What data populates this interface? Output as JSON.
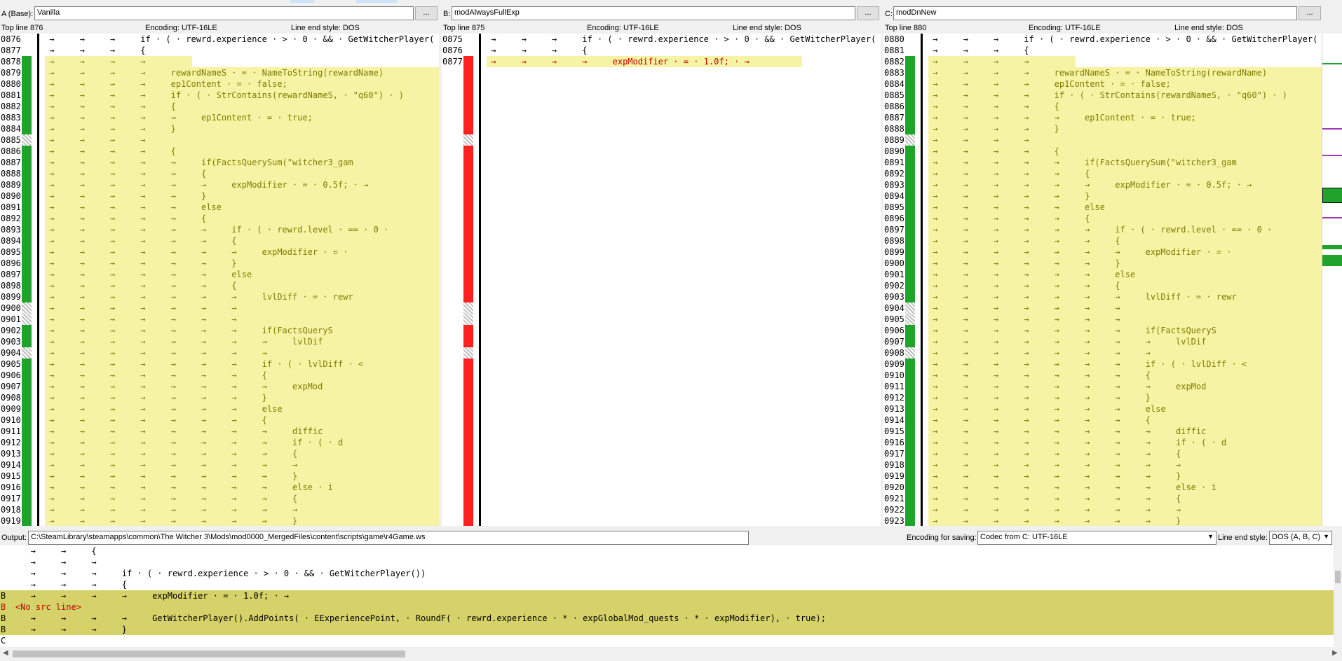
{
  "panes": [
    {
      "id": "A",
      "label": "A (Base):",
      "name": "Vanilla",
      "browse": "...",
      "top_line": "Top line 876",
      "encoding": "Encoding: UTF-16LE",
      "line_end": "Line end style: DOS",
      "lines": [
        {
          "n": "0876",
          "code": " →     →     →     if · ( · rewrd.experience · > · 0 · && · GetWitcherPlayer(",
          "mark": "",
          "hl": false
        },
        {
          "n": "0877",
          "code": " →     →     →     {",
          "mark": "",
          "hl": false
        },
        {
          "n": "0878",
          "code": " →     →     →     →",
          "mark": "green",
          "hl": true,
          "hlw": 210
        },
        {
          "n": "0879",
          "code": " →     →     →     →     rewardNameS · = · NameToString(rewardName)",
          "mark": "green",
          "hl": true
        },
        {
          "n": "0880",
          "code": " →     →     →     →     ep1Content · = · false;",
          "mark": "green",
          "hl": true
        },
        {
          "n": "0881",
          "code": " →     →     →     →     if · ( · StrContains(rewardNameS, · \"q60\") · )",
          "mark": "green",
          "hl": true
        },
        {
          "n": "0882",
          "code": " →     →     →     →     {",
          "mark": "green",
          "hl": true
        },
        {
          "n": "0883",
          "code": " →     →     →     →     →     ep1Content · = · true;",
          "mark": "green",
          "hl": true
        },
        {
          "n": "0884",
          "code": " →     →     →     →     }",
          "mark": "green",
          "hl": true
        },
        {
          "n": "0885",
          "code": " →     →     →     →",
          "mark": "hatch",
          "hl": true
        },
        {
          "n": "0886",
          "code": " →     →     →     →     {",
          "mark": "green",
          "hl": true
        },
        {
          "n": "0887",
          "code": " →     →     →     →     →     if(FactsQuerySum(\"witcher3_gam",
          "mark": "green",
          "hl": true
        },
        {
          "n": "0888",
          "code": " →     →     →     →     →     {",
          "mark": "green",
          "hl": true
        },
        {
          "n": "0889",
          "code": " →     →     →     →     →     →     expModifier · = · 0.5f; · →",
          "mark": "green",
          "hl": true
        },
        {
          "n": "0890",
          "code": " →     →     →     →     →     }",
          "mark": "green",
          "hl": true
        },
        {
          "n": "0891",
          "code": " →     →     →     →     →     else",
          "mark": "green",
          "hl": true
        },
        {
          "n": "0892",
          "code": " →     →     →     →     →     {",
          "mark": "green",
          "hl": true
        },
        {
          "n": "0893",
          "code": " →     →     →     →     →     →     if · ( · rewrd.level · == · 0 ·",
          "mark": "green",
          "hl": true
        },
        {
          "n": "0894",
          "code": " →     →     →     →     →     →     {",
          "mark": "green",
          "hl": true
        },
        {
          "n": "0895",
          "code": " →     →     →     →     →     →     →     expModifier · = ·",
          "mark": "green",
          "hl": true
        },
        {
          "n": "0896",
          "code": " →     →     →     →     →     →     }",
          "mark": "green",
          "hl": true
        },
        {
          "n": "0897",
          "code": " →     →     →     →     →     →     else",
          "mark": "green",
          "hl": true
        },
        {
          "n": "0898",
          "code": " →     →     →     →     →     →     {",
          "mark": "green",
          "hl": true
        },
        {
          "n": "0899",
          "code": " →     →     →     →     →     →     →     lvlDiff · = · rewr",
          "mark": "green",
          "hl": true
        },
        {
          "n": "0900",
          "code": " →     →     →     →     →     →     →",
          "mark": "hatch",
          "hl": true
        },
        {
          "n": "0901",
          "code": " →     →     →     →     →     →     →",
          "mark": "hatch",
          "hl": true
        },
        {
          "n": "0902",
          "code": " →     →     →     →     →     →     →     if(FactsQueryS",
          "mark": "green",
          "hl": true
        },
        {
          "n": "0903",
          "code": " →     →     →     →     →     →     →     →     lvlDif",
          "mark": "green",
          "hl": true
        },
        {
          "n": "0904",
          "code": " →     →     →     →     →     →     →     →",
          "mark": "hatch",
          "hl": true
        },
        {
          "n": "0905",
          "code": " →     →     →     →     →     →     →     if · ( · lvlDiff · <",
          "mark": "green",
          "hl": true
        },
        {
          "n": "0906",
          "code": " →     →     →     →     →     →     →     {",
          "mark": "green",
          "hl": true
        },
        {
          "n": "0907",
          "code": " →     →     →     →     →     →     →     →     expMod",
          "mark": "green",
          "hl": true
        },
        {
          "n": "0908",
          "code": " →     →     →     →     →     →     →     }",
          "mark": "green",
          "hl": true
        },
        {
          "n": "0909",
          "code": " →     →     →     →     →     →     →     else",
          "mark": "green",
          "hl": true
        },
        {
          "n": "0910",
          "code": " →     →     →     →     →     →     →     {",
          "mark": "green",
          "hl": true
        },
        {
          "n": "0911",
          "code": " →     →     →     →     →     →     →     →     diffic",
          "mark": "green",
          "hl": true
        },
        {
          "n": "0912",
          "code": " →     →     →     →     →     →     →     →     if · ( · d",
          "mark": "green",
          "hl": true
        },
        {
          "n": "0913",
          "code": " →     →     →     →     →     →     →     →     {",
          "mark": "green",
          "hl": true
        },
        {
          "n": "0914",
          "code": " →     →     →     →     →     →     →     →     →",
          "mark": "green",
          "hl": true
        },
        {
          "n": "0915",
          "code": " →     →     →     →     →     →     →     →     }",
          "mark": "green",
          "hl": true
        },
        {
          "n": "0916",
          "code": " →     →     →     →     →     →     →     →     else · i",
          "mark": "green",
          "hl": true
        },
        {
          "n": "0917",
          "code": " →     →     →     →     →     →     →     →     {",
          "mark": "green",
          "hl": true
        },
        {
          "n": "0918",
          "code": " →     →     →     →     →     →     →     →     →",
          "mark": "green",
          "hl": true
        },
        {
          "n": "0919",
          "code": " →     →     →     →     →     →     →     →     }",
          "mark": "green",
          "hl": true
        }
      ]
    },
    {
      "id": "B",
      "label": "B:",
      "name": "modAlwaysFullExp",
      "browse": "...",
      "top_line": "Top line 875",
      "encoding": "Encoding: UTF-16LE",
      "line_end": "Line end style: DOS",
      "lines": [
        {
          "n": "0875",
          "code": " →     →     →     if · ( · rewrd.experience · > · 0 · && · GetWitcherPlayer(",
          "mark": "",
          "hl": false
        },
        {
          "n": "0876",
          "code": " →     →     →     {",
          "mark": "",
          "hl": false
        },
        {
          "n": "0877",
          "code": " →     →     →     →     expModifier · = · 1.0f; · →",
          "mark": "red",
          "hl": true,
          "hlw": 450,
          "red": true
        }
      ],
      "empty_marks": [
        "red",
        "red",
        "red",
        "red",
        "red",
        "red",
        "hatch",
        "red",
        "red",
        "red",
        "red",
        "red",
        "red",
        "red",
        "red",
        "red",
        "red",
        "red",
        "red",
        "red",
        "red",
        "hatch",
        "hatch",
        "red",
        "red",
        "hatch",
        "red",
        "red",
        "red",
        "red",
        "red",
        "red",
        "red",
        "red",
        "red",
        "red",
        "red",
        "red",
        "red",
        "red",
        "red"
      ]
    },
    {
      "id": "C",
      "label": "C:",
      "name": "modDnNew",
      "browse": "...",
      "top_line": "Top line 880",
      "encoding": "Encoding: UTF-16LE",
      "line_end": "Line end style: DOS",
      "lines": [
        {
          "n": "0880",
          "code": " →     →     →     if · ( · rewrd.experience · > · 0 · && · GetWitcherPlayer(",
          "mark": "",
          "hl": false
        },
        {
          "n": "0881",
          "code": " →     →     →     {",
          "mark": "",
          "hl": false
        },
        {
          "n": "0882",
          "code": " →     →     →     →",
          "mark": "green",
          "hl": true,
          "hlw": 210
        },
        {
          "n": "0883",
          "code": " →     →     →     →     rewardNameS · = · NameToString(rewardName)",
          "mark": "green",
          "hl": true
        },
        {
          "n": "0884",
          "code": " →     →     →     →     ep1Content · = · false;",
          "mark": "green",
          "hl": true
        },
        {
          "n": "0885",
          "code": " →     →     →     →     if · ( · StrContains(rewardNameS, · \"q60\") · )",
          "mark": "green",
          "hl": true
        },
        {
          "n": "0886",
          "code": " →     →     →     →     {",
          "mark": "green",
          "hl": true
        },
        {
          "n": "0887",
          "code": " →     →     →     →     →     ep1Content · = · true;",
          "mark": "green",
          "hl": true
        },
        {
          "n": "0888",
          "code": " →     →     →     →     }",
          "mark": "green",
          "hl": true
        },
        {
          "n": "0889",
          "code": " →     →     →     →",
          "mark": "hatch",
          "hl": true
        },
        {
          "n": "0890",
          "code": " →     →     →     →     {",
          "mark": "green",
          "hl": true
        },
        {
          "n": "0891",
          "code": " →     →     →     →     →     if(FactsQuerySum(\"witcher3_gam",
          "mark": "green",
          "hl": true
        },
        {
          "n": "0892",
          "code": " →     →     →     →     →     {",
          "mark": "green",
          "hl": true
        },
        {
          "n": "0893",
          "code": " →     →     →     →     →     →     expModifier · = · 0.5f; · →",
          "mark": "green",
          "hl": true
        },
        {
          "n": "0894",
          "code": " →     →     →     →     →     }",
          "mark": "green",
          "hl": true
        },
        {
          "n": "0895",
          "code": " →     →     →     →     →     else",
          "mark": "green",
          "hl": true
        },
        {
          "n": "0896",
          "code": " →     →     →     →     →     {",
          "mark": "green",
          "hl": true
        },
        {
          "n": "0897",
          "code": " →     →     →     →     →     →     if · ( · rewrd.level · == · 0 ·",
          "mark": "green",
          "hl": true
        },
        {
          "n": "0898",
          "code": " →     →     →     →     →     →     {",
          "mark": "green",
          "hl": true
        },
        {
          "n": "0899",
          "code": " →     →     →     →     →     →     →     expModifier · = ·",
          "mark": "green",
          "hl": true
        },
        {
          "n": "0900",
          "code": " →     →     →     →     →     →     }",
          "mark": "green",
          "hl": true
        },
        {
          "n": "0901",
          "code": " →     →     →     →     →     →     else",
          "mark": "green",
          "hl": true
        },
        {
          "n": "0902",
          "code": " →     →     →     →     →     →     {",
          "mark": "green",
          "hl": true
        },
        {
          "n": "0903",
          "code": " →     →     →     →     →     →     →     lvlDiff · = · rewr",
          "mark": "green",
          "hl": true
        },
        {
          "n": "0904",
          "code": " →     →     →     →     →     →     →",
          "mark": "hatch",
          "hl": true
        },
        {
          "n": "0905",
          "code": " →     →     →     →     →     →     →",
          "mark": "hatch",
          "hl": true
        },
        {
          "n": "0906",
          "code": " →     →     →     →     →     →     →     if(FactsQueryS",
          "mark": "green",
          "hl": true
        },
        {
          "n": "0907",
          "code": " →     →     →     →     →     →     →     →     lvlDif",
          "mark": "green",
          "hl": true
        },
        {
          "n": "0908",
          "code": " →     →     →     →     →     →     →     →",
          "mark": "hatch",
          "hl": true
        },
        {
          "n": "0909",
          "code": " →     →     →     →     →     →     →     if · ( · lvlDiff · <",
          "mark": "green",
          "hl": true
        },
        {
          "n": "0910",
          "code": " →     →     →     →     →     →     →     {",
          "mark": "green",
          "hl": true
        },
        {
          "n": "0911",
          "code": " →     →     →     →     →     →     →     →     expMod",
          "mark": "green",
          "hl": true
        },
        {
          "n": "0912",
          "code": " →     →     →     →     →     →     →     }",
          "mark": "green",
          "hl": true
        },
        {
          "n": "0913",
          "code": " →     →     →     →     →     →     →     else",
          "mark": "green",
          "hl": true
        },
        {
          "n": "0914",
          "code": " →     →     →     →     →     →     →     {",
          "mark": "green",
          "hl": true
        },
        {
          "n": "0915",
          "code": " →     →     →     →     →     →     →     →     diffic",
          "mark": "green",
          "hl": true
        },
        {
          "n": "0916",
          "code": " →     →     →     →     →     →     →     →     if · ( · d",
          "mark": "green",
          "hl": true
        },
        {
          "n": "0917",
          "code": " →     →     →     →     →     →     →     →     {",
          "mark": "green",
          "hl": true
        },
        {
          "n": "0918",
          "code": " →     →     →     →     →     →     →     →     →",
          "mark": "green",
          "hl": true
        },
        {
          "n": "0919",
          "code": " →     →     →     →     →     →     →     →     }",
          "mark": "green",
          "hl": true
        },
        {
          "n": "0920",
          "code": " →     →     →     →     →     →     →     →     else · i",
          "mark": "green",
          "hl": true
        },
        {
          "n": "0921",
          "code": " →     →     →     →     →     →     →     →     {",
          "mark": "green",
          "hl": true
        },
        {
          "n": "0922",
          "code": " →     →     →     →     →     →     →     →     →",
          "mark": "green",
          "hl": true
        },
        {
          "n": "0923",
          "code": " →     →     →     →     →     →     →     →     }",
          "mark": "green",
          "hl": true
        }
      ]
    }
  ],
  "output": {
    "label": "Output:",
    "path": "C:\\SteamLibrary\\steamapps\\common\\The Witcher 3\\Mods\\mod0000_MergedFiles\\content\\scripts\\game\\r4Game.ws",
    "encoding_label": "Encoding for saving:",
    "encoding_value": "Codec from C: UTF-16LE",
    "line_end_label": "Line end style:",
    "line_end_value": "DOS (A, B, C)",
    "lines": [
      {
        "src": "",
        "text": "   →     →     {",
        "sel": false
      },
      {
        "src": "",
        "text": "   →     →     →",
        "sel": false
      },
      {
        "src": "",
        "text": "   →     →     →     if · ( · rewrd.experience · > · 0 · && · GetWitcherPlayer())",
        "sel": false
      },
      {
        "src": "",
        "text": "   →     →     →     {",
        "sel": false
      },
      {
        "src": "B",
        "text": "   →     →     →     →     expModifier · = · 1.0f; · →",
        "sel": true
      },
      {
        "src": "B",
        "text": "<No src line>",
        "sel": true,
        "red": true
      },
      {
        "src": "B",
        "text": "   →     →     →     →     GetWitcherPlayer().AddPoints( · EExperiencePoint, · RoundF( · rewrd.experience · * · expGlobalMod_quests · * · expModifier), · true);",
        "sel": true
      },
      {
        "src": "B",
        "text": "   →     →     →     }",
        "sel": true
      },
      {
        "src": "C",
        "text": "",
        "sel": false
      }
    ]
  },
  "colors": {
    "changed_highlight": "#f7f3a4",
    "selected_output": "#d6d26a",
    "green_marker": "#1fa32b",
    "red_marker": "#ff2020",
    "changed_text": "#7d7d00",
    "missing_text": "#c00000"
  }
}
